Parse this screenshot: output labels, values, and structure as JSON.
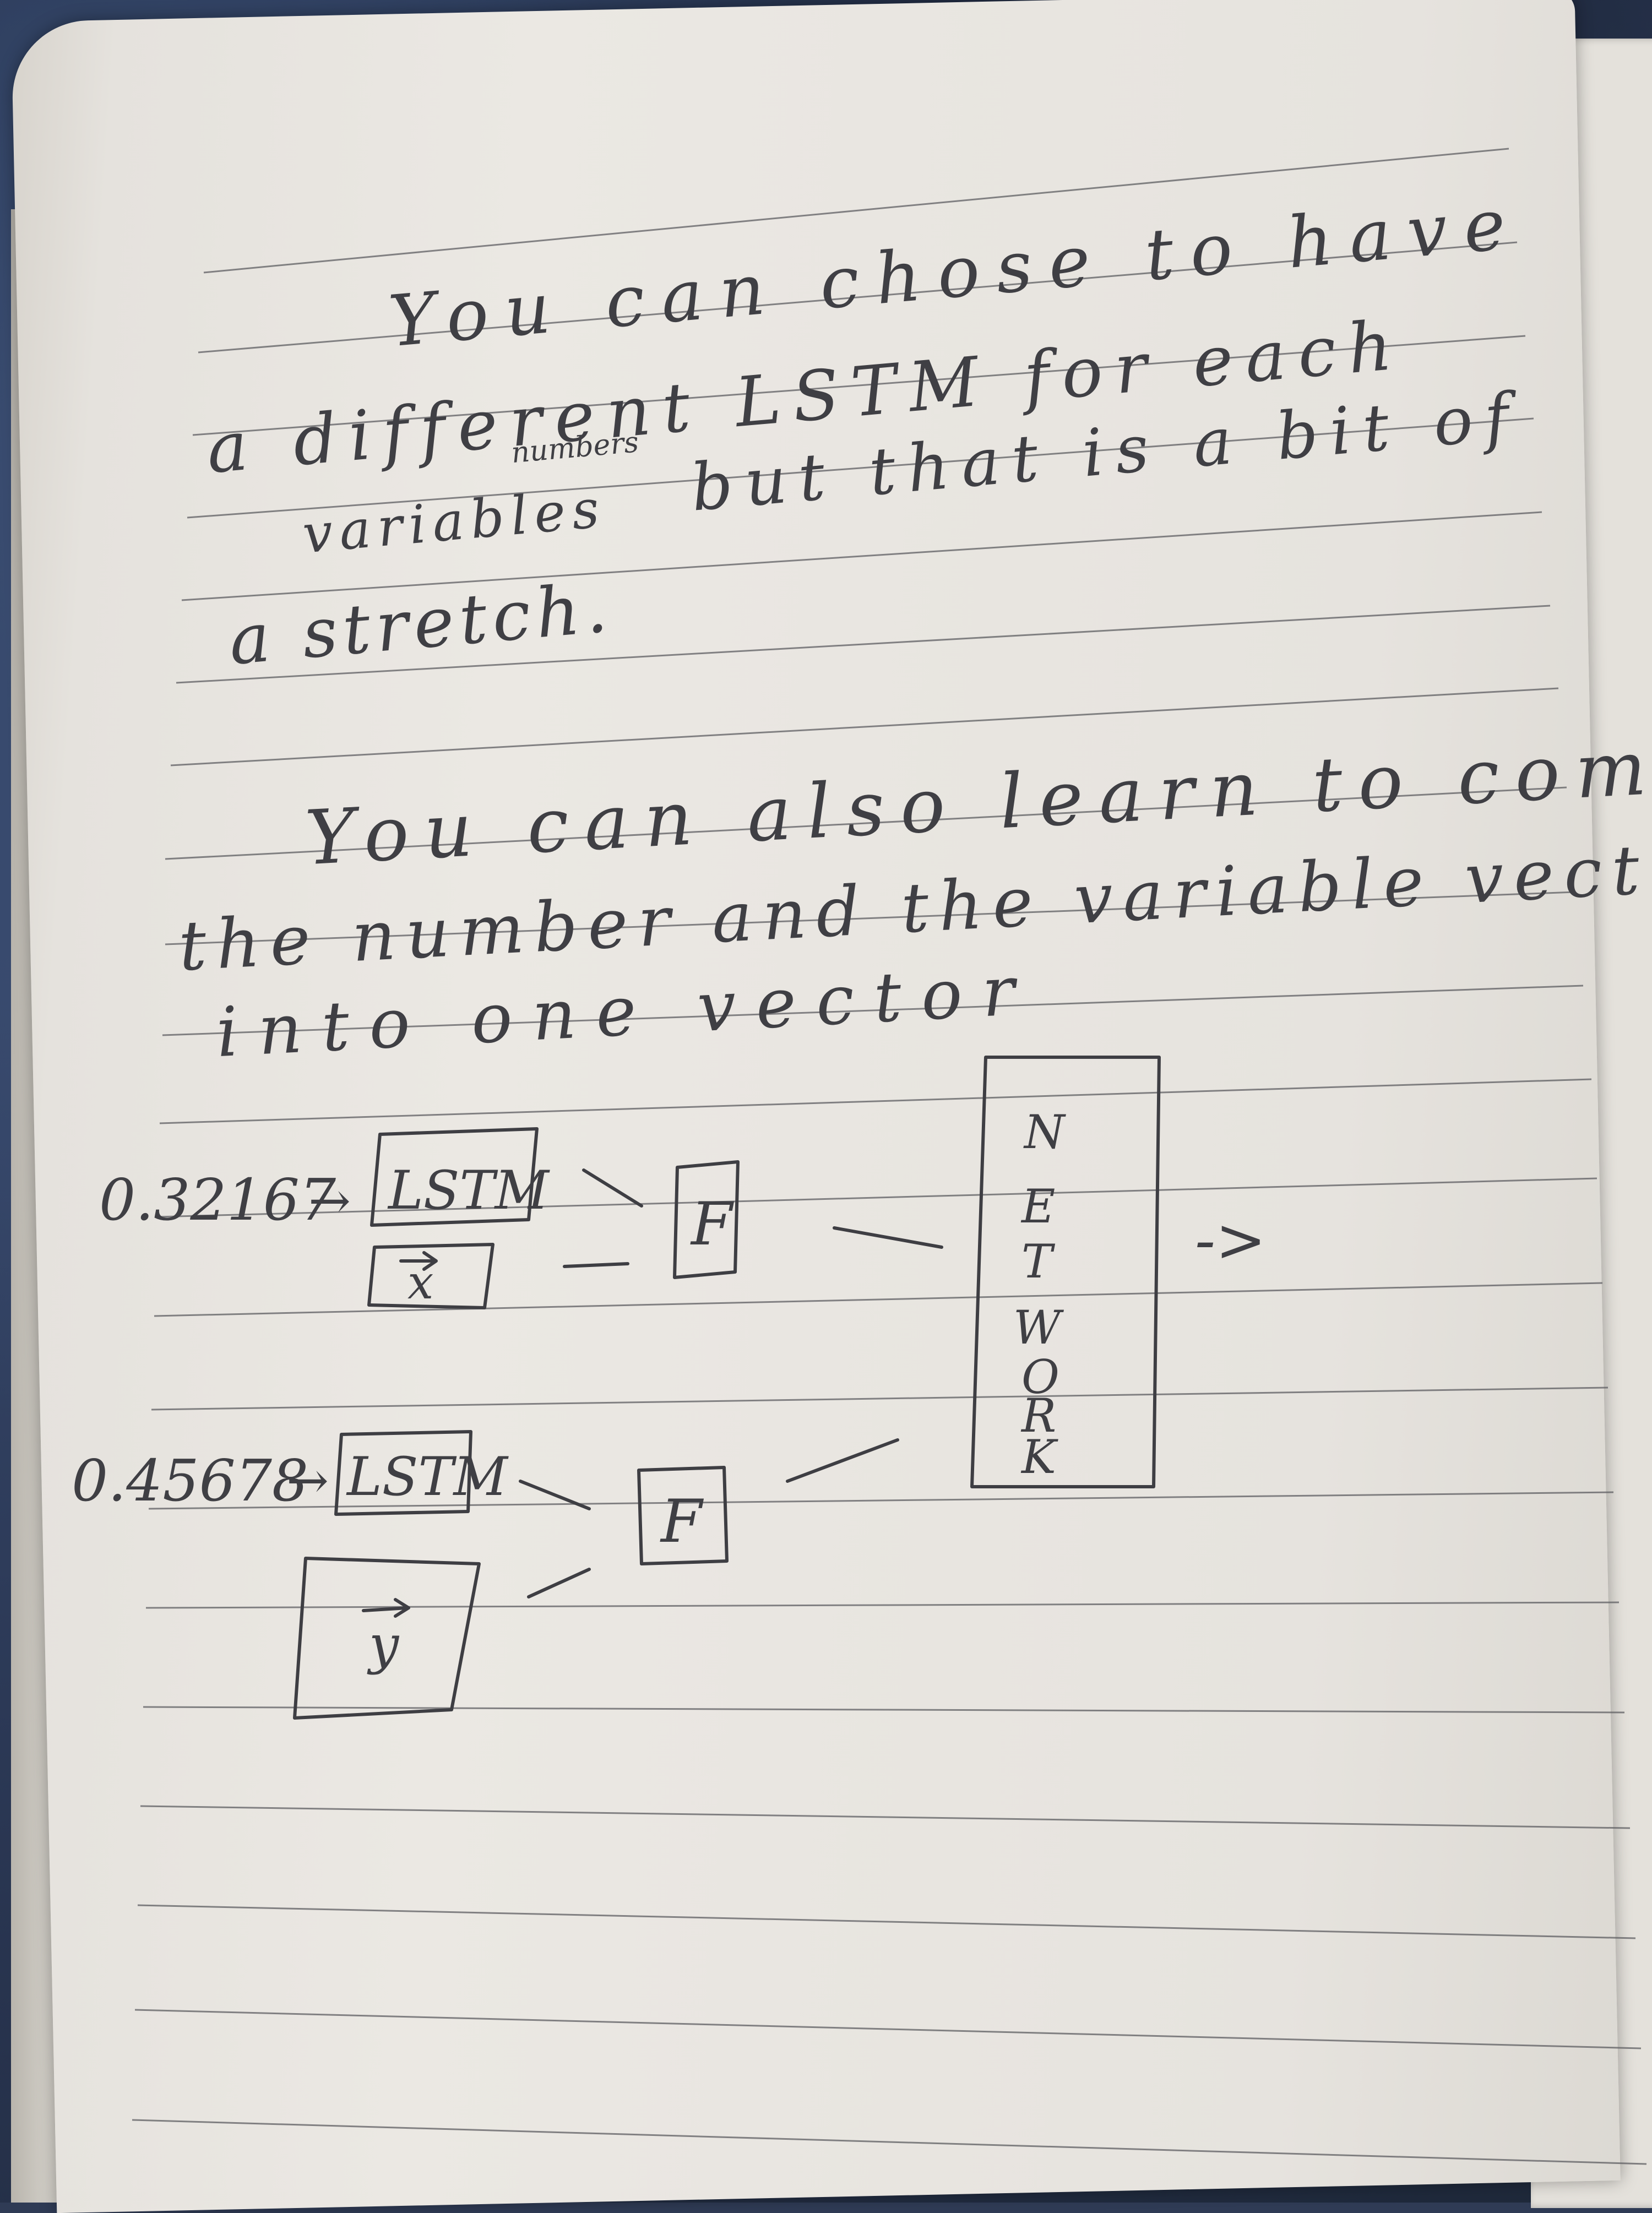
{
  "note": {
    "paragraph1": [
      "You can chose to have",
      "a different LSTM for each",
      "variables",
      "numbers",
      "but that is a bit of",
      "a stretch."
    ],
    "paragraph2": [
      "You can also learn to compose",
      "the number and the variable vector",
      "into one vector"
    ]
  },
  "diagram": {
    "input1_value": "0.32167",
    "input2_value": "0.45678",
    "lstm_label": "LSTM",
    "vector_x": "x",
    "vector_y": "y",
    "f_label": "F",
    "network_letters": [
      "N",
      "E",
      "T",
      "W",
      "O",
      "R",
      "K"
    ],
    "arrow_glyph": "→",
    "output_arrow": "->"
  }
}
